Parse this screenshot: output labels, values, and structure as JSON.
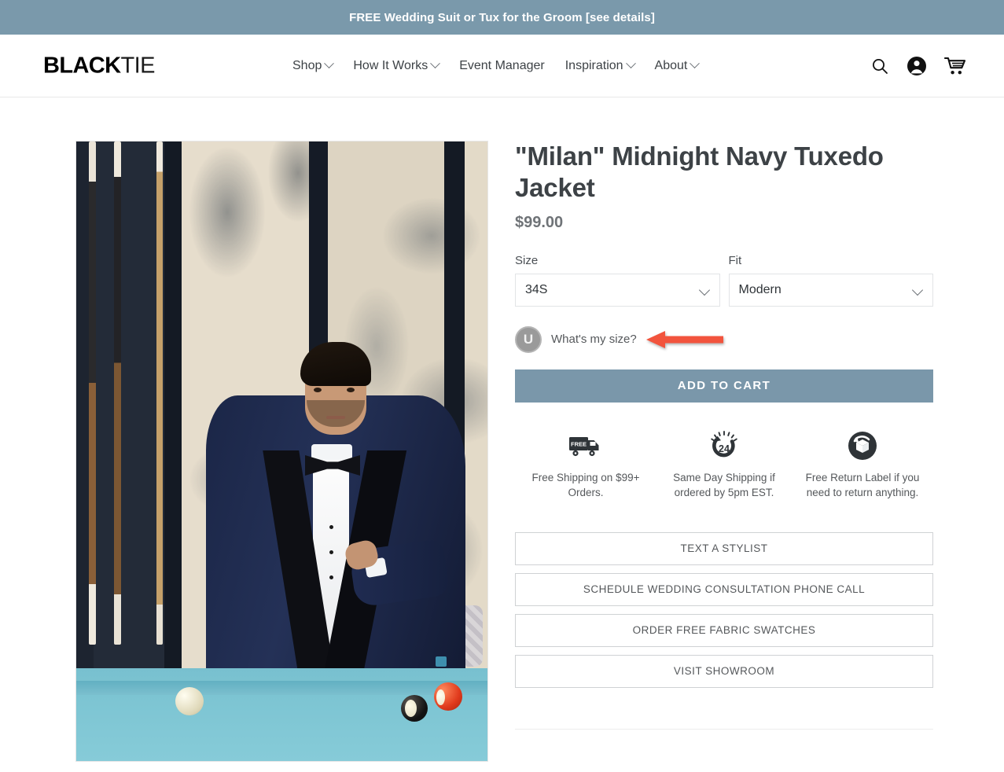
{
  "announcement": {
    "text": "FREE Wedding Suit or Tux for the Groom [see details]"
  },
  "header": {
    "logo_bold": "BLACK",
    "logo_light": "TIE",
    "nav": [
      {
        "label": "Shop",
        "has_caret": true
      },
      {
        "label": "How It Works",
        "has_caret": true
      },
      {
        "label": "Event Manager",
        "has_caret": false
      },
      {
        "label": "Inspiration",
        "has_caret": true
      },
      {
        "label": "About",
        "has_caret": true
      }
    ],
    "icons": [
      {
        "name": "search-icon"
      },
      {
        "name": "account-icon"
      },
      {
        "name": "cart-icon"
      }
    ]
  },
  "product": {
    "title": "\"Milan\" Midnight Navy Tuxedo Jacket",
    "price": "$99.00",
    "image_alt": "Model wearing midnight navy tuxedo jacket with black shawl lapels and bow tie beside a pool table",
    "options": [
      {
        "label": "Size",
        "value": "34S"
      },
      {
        "label": "Fit",
        "value": "Modern"
      }
    ],
    "size_help": {
      "badge_letter": "U",
      "label": "What's my size?"
    },
    "add_to_cart_label": "ADD TO CART",
    "benefits": [
      {
        "icon": "free-shipping-truck-icon",
        "text": "Free Shipping on $99+ Orders."
      },
      {
        "icon": "same-day-shipping-24-clock-icon",
        "text": "Same Day Shipping if ordered by 5pm EST."
      },
      {
        "icon": "free-return-label-box-icon",
        "text": "Free Return Label if you need to return anything."
      }
    ],
    "actions": [
      "TEXT A STYLIST",
      "SCHEDULE WEDDING CONSULTATION PHONE CALL",
      "ORDER FREE FABRIC SWATCHES",
      "VISIT SHOWROOM"
    ]
  },
  "annotation": {
    "type": "red-left-arrow",
    "color": "#f2543d",
    "points_to": "What's my size?"
  },
  "colors": {
    "accent_slate": "#7a99ab",
    "button_slate": "#7a97aa",
    "text_dark": "#3d4246",
    "annotation_red": "#f2543d"
  }
}
